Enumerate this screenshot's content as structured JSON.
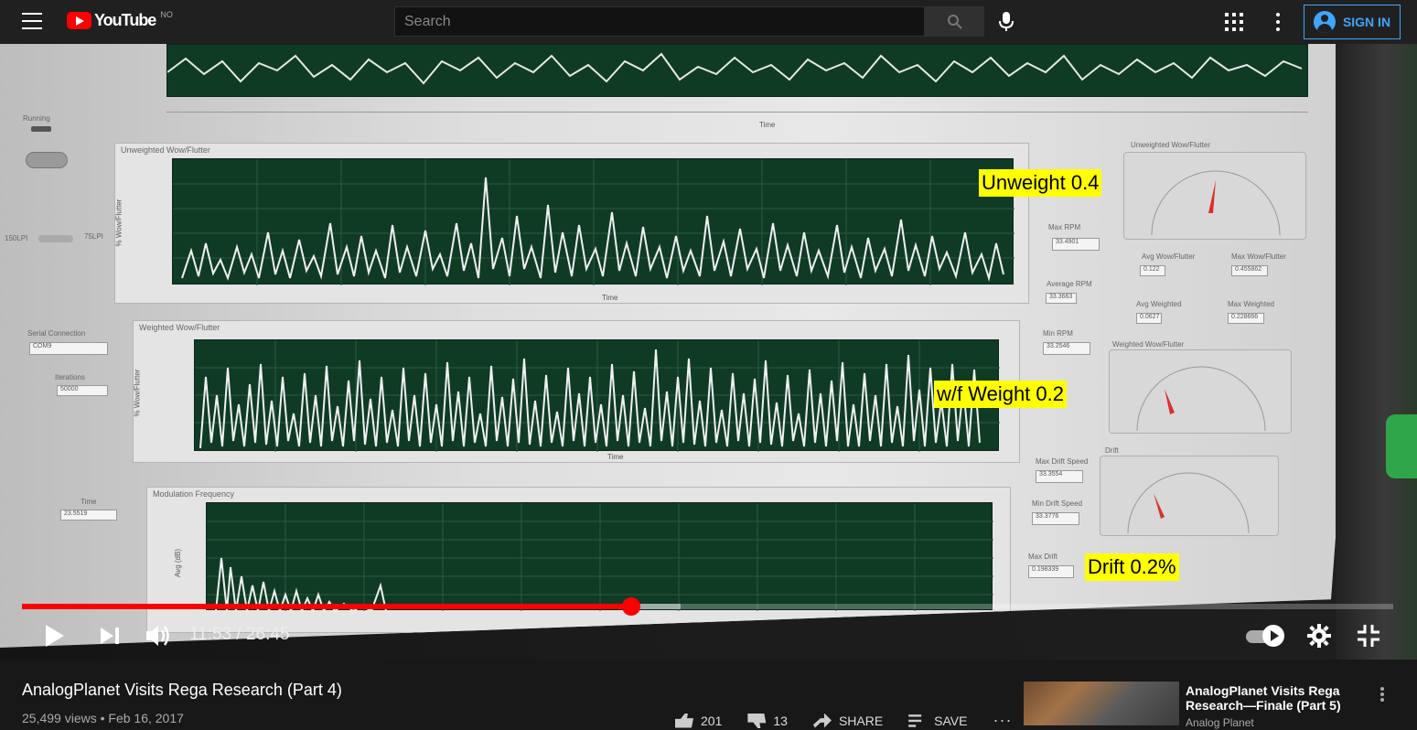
{
  "masthead": {
    "logo_text": "YouTube",
    "region": "NO",
    "search_placeholder": "Search",
    "sign_in_label": "SIGN IN"
  },
  "player": {
    "current_time": "11:53",
    "duration": "26:45",
    "time_display": "11:53 / 26:45",
    "progress_fraction": 0.444,
    "buffered_fraction": 0.48,
    "annotations": {
      "unweight": "Unweight 0.4",
      "weight": "w/f Weight 0.2",
      "drift": "Drift 0.2%"
    },
    "screen": {
      "panel_unweighted": "Unweighted Wow/Flutter",
      "panel_weighted": "Weighted Wow/Flutter",
      "panel_modulation": "Modulation Frequency",
      "axis_time": "Time",
      "y_unweighted": "% Wow/Flutter",
      "y_weighted": "% Wow/Flutter",
      "y_modulation": "Avg (dB)",
      "running": "Running",
      "lpi_150": "150LPI",
      "lpi_75": "75LPI",
      "serial_connection": "Serial Connection",
      "serial_value": "COM9",
      "iterations": "Iterations",
      "iterations_value": "50000",
      "time_label": "Time",
      "time_value": "23.5519",
      "max_rpm": "Max RPM",
      "max_rpm_value": "33.4901",
      "avg_rpm": "Average RPM",
      "avg_rpm_value": "33.3663",
      "min_rpm": "Min RPM",
      "min_rpm_value": "33.2546",
      "max_drift": "Max Drift Speed",
      "max_drift_value": "33.3554",
      "min_drift": "Min Drift Speed",
      "min_drift_value": "33.3776",
      "max_drift_pct": "Max Drift",
      "max_drift_pct_value": "0.198339",
      "gauge_unweighted": "Unweighted Wow/Flutter",
      "gauge_weighted": "Weighted Wow/Flutter",
      "gauge_drift": "Drift",
      "avg_wow": "Avg Wow/Flutter",
      "avg_wow_value": "0.122",
      "max_wow": "Max Wow/Flutter",
      "max_wow_value": "0.455862",
      "avg_weighted": "Avg Weighted",
      "avg_weighted_value": "0.0627",
      "max_weighted": "Max Weighted",
      "max_weighted_value": "0.228666"
    }
  },
  "video": {
    "title": "AnalogPlanet Visits Rega Research (Part 4)",
    "meta": "25,499 views • Feb 16, 2017",
    "likes": "201",
    "dislikes": "13",
    "share_label": "SHARE",
    "save_label": "SAVE"
  },
  "recommendation": {
    "title": "AnalogPlanet Visits Rega Research—Finale (Part 5)",
    "channel": "Analog Planet"
  },
  "colors": {
    "accent_red": "#ff0000",
    "sign_in_blue": "#3ea6ff",
    "annotation_yellow": "#ffff00",
    "plot_green": "#0f3b25"
  }
}
